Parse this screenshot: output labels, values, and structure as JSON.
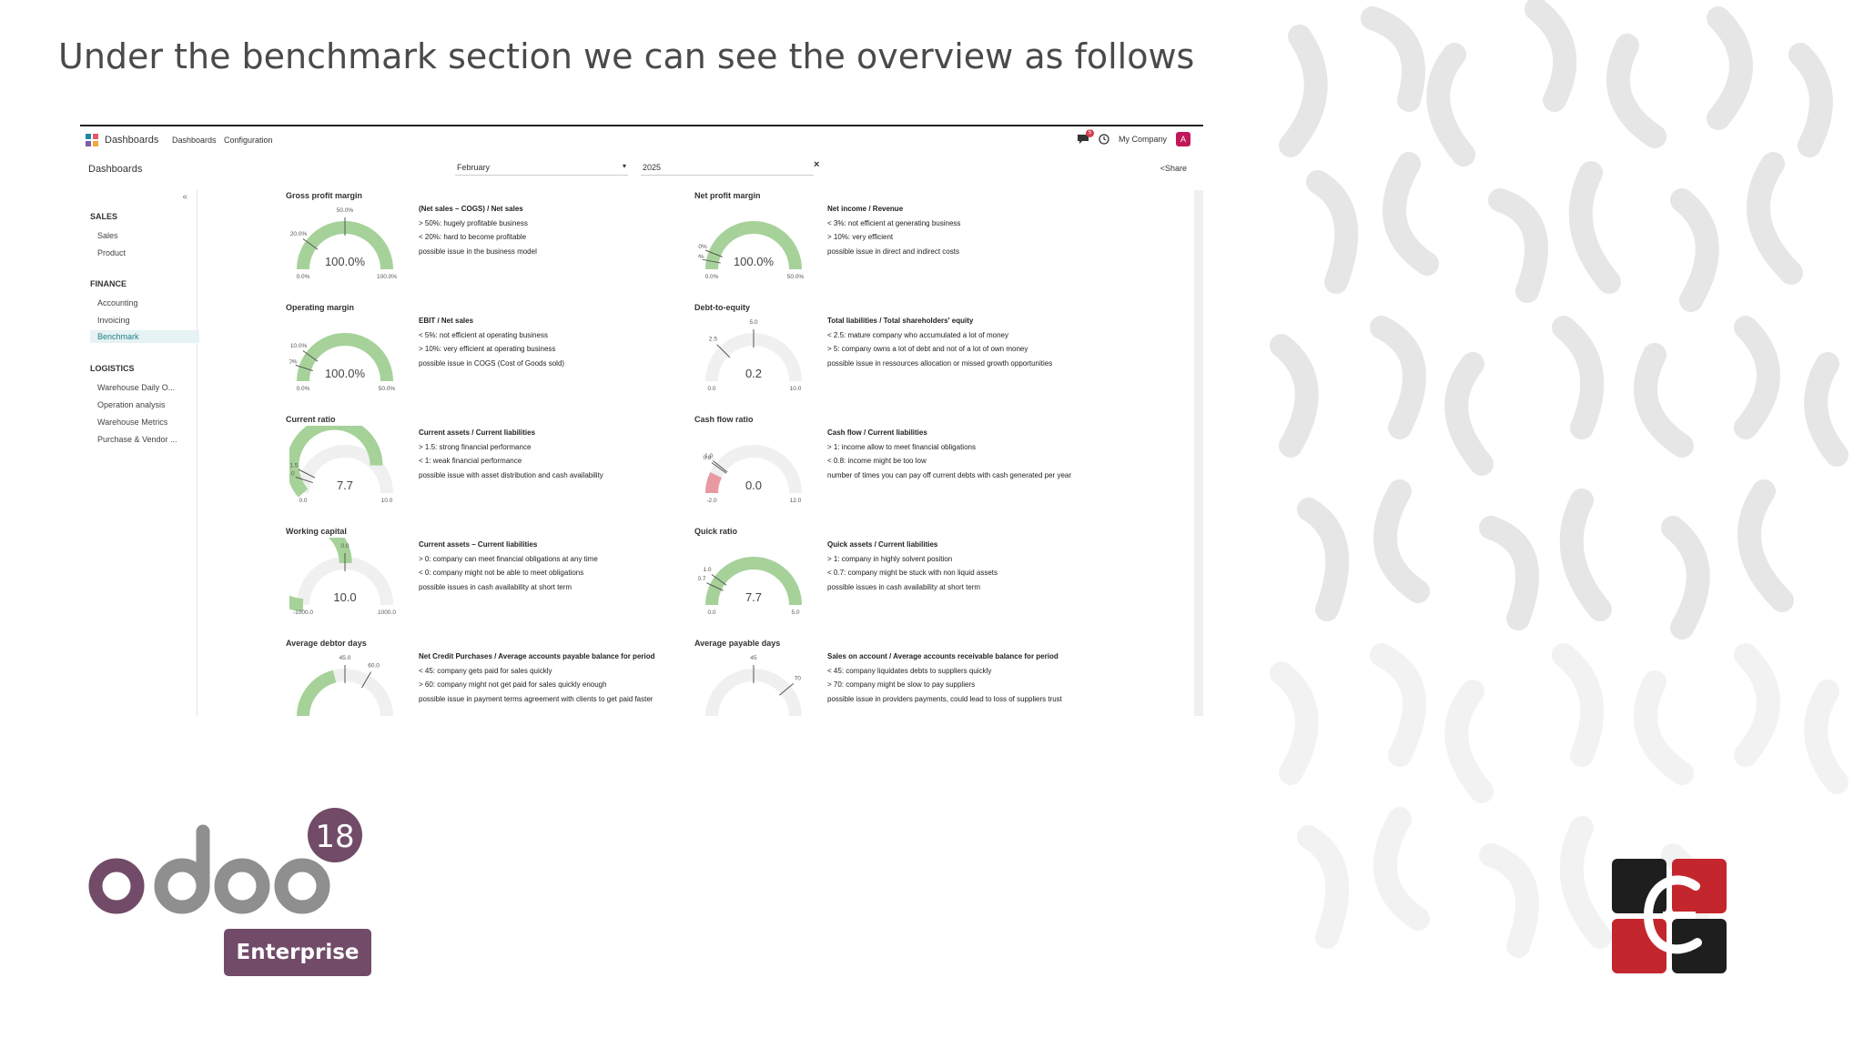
{
  "slide": {
    "title": "Under the benchmark section we can see the overview as follows"
  },
  "navbar": {
    "app_name": "Dashboards",
    "menu": [
      "Dashboards",
      "Configuration"
    ],
    "chat_badge": "5",
    "company": "My Company",
    "avatar_letter": "A"
  },
  "control": {
    "breadcrumb": "Dashboards",
    "month": "February",
    "year": "2025",
    "clear": "×",
    "share": "Share"
  },
  "sidebar": {
    "collapse": "«",
    "sections": [
      {
        "title": "SALES",
        "items": [
          "Sales",
          "Product"
        ]
      },
      {
        "title": "FINANCE",
        "items": [
          "Accounting",
          "Invoicing",
          "Benchmark"
        ]
      },
      {
        "title": "LOGISTICS",
        "items": [
          "Warehouse Daily O...",
          "Operation analysis",
          "Warehouse Metrics",
          "Purchase & Vendor ..."
        ]
      }
    ],
    "active": "Benchmark"
  },
  "metrics": [
    {
      "title": "Gross profit margin",
      "value": "100.0%",
      "min": "0.0%",
      "max": "100.0%",
      "fraction": 1.0,
      "color": "#a6d29a",
      "marks": [
        {
          "label": "20.0%",
          "f": 0.2
        },
        {
          "label": "50.0%",
          "f": 0.5
        }
      ],
      "formula": "(Net sales – COGS) / Net sales",
      "lines": [
        "> 50%: hugely profitable business",
        "< 20%: hard to become profitable",
        "possible issue in the business model"
      ]
    },
    {
      "title": "Net profit margin",
      "value": "100.0%",
      "min": "0.0%",
      "max": "50.0%",
      "fraction": 1.0,
      "color": "#a6d29a",
      "marks": [
        {
          "label": "3.0%",
          "f": 0.06
        },
        {
          "label": "6.0%",
          "f": 0.12
        }
      ],
      "formula": "Net income / Revenue",
      "lines": [
        "< 3%: not efficient at generating business",
        "> 10%: very efficient",
        "possible issue in direct and indirect costs"
      ]
    },
    {
      "title": "Operating margin",
      "value": "100.0%",
      "min": "0.0%",
      "max": "50.0%",
      "fraction": 1.0,
      "color": "#a6d29a",
      "marks": [
        {
          "label": "5.0%",
          "f": 0.1
        },
        {
          "label": "10.0%",
          "f": 0.2
        }
      ],
      "formula": "EBIT / Net sales",
      "lines": [
        "< 5%: not efficient at operating business",
        "> 10%: very efficient at operating business",
        "possible issue in COGS (Cost of Goods sold)"
      ]
    },
    {
      "title": "Debt-to-equity",
      "value": "0.2",
      "min": "0.0",
      "max": "10.0",
      "fraction": 0.0,
      "color": "#a6d29a",
      "marks": [
        {
          "label": "2.5",
          "f": 0.25
        },
        {
          "label": "5.0",
          "f": 0.5
        }
      ],
      "formula": "Total liabilities / Total shareholders' equity",
      "lines": [
        "< 2.5: mature company who accumulated a lot of money",
        "> 5: company owns a lot of debt and not of a lot of own money",
        "possible issue in ressources allocation or missed growth opportunities"
      ]
    },
    {
      "title": "Current ratio",
      "value": "7.7",
      "min": "0.0",
      "max": "10.0",
      "fraction": 0.77,
      "color": "#a6d29a",
      "marks": [
        {
          "label": "1.0",
          "f": 0.1
        },
        {
          "label": "1.5",
          "f": 0.15
        }
      ],
      "formula": "Current assets / Current liabilities",
      "lines": [
        "> 1.5: strong financial performance",
        "< 1: weak financial performance",
        "possible issue with asset distribution and cash availability"
      ]
    },
    {
      "title": "Cash flow ratio",
      "value": "0.0",
      "min": "-2.0",
      "max": "12.0",
      "fraction": 0.143,
      "color": "#e89aa0",
      "marks": [
        {
          "label": "0.8",
          "f": 0.2
        },
        {
          "label": "1.0",
          "f": 0.214
        }
      ],
      "formula": "Cash flow / Current liabilities",
      "lines": [
        "> 1: income allow to meet financial obligations",
        "< 0.8: income might be too low",
        "number of times you can pay off current debts with cash generated per year"
      ]
    },
    {
      "title": "Working capital",
      "value": "10.0",
      "min": "-1000.0",
      "max": "1000.0",
      "fraction": 0.505,
      "color": "#a6d29a",
      "marks": [
        {
          "label": "0.0",
          "f": 0.5
        }
      ],
      "formula": "Current assets – Current liabilities",
      "lines": [
        "> 0: company can meet financial obligations at any time",
        "< 0: company might not be able to meet obligations",
        "possible issues in cash availability at short term"
      ]
    },
    {
      "title": "Quick ratio",
      "value": "7.7",
      "min": "0.0",
      "max": "5.0",
      "fraction": 1.0,
      "color": "#a6d29a",
      "marks": [
        {
          "label": "0.7",
          "f": 0.14
        },
        {
          "label": "1.0",
          "f": 0.2
        }
      ],
      "formula": "Quick assets / Current liabilities",
      "lines": [
        "> 1: company in highly solvent position",
        "< 0.7: company might be stuck with non liquid assets",
        "possible issues in cash availability at short term"
      ]
    },
    {
      "title": "Average debtor days",
      "value": "",
      "min": "",
      "max": "",
      "fraction": 0.42,
      "color": "#a6d29a",
      "marks": [
        {
          "label": "45.0",
          "f": 0.5
        },
        {
          "label": "60.0",
          "f": 0.667
        }
      ],
      "formula": "Net Credit Purchases / Average accounts payable balance for period",
      "lines": [
        "< 45: company gets paid for sales quickly",
        "> 60: company might not get paid for sales quickly enough",
        "possible issue in payment terms agreement with clients to get paid faster"
      ]
    },
    {
      "title": "Average payable days",
      "value": "",
      "min": "",
      "max": "",
      "fraction": 0.0,
      "color": "#a6d29a",
      "marks": [
        {
          "label": "45",
          "f": 0.5
        },
        {
          "label": "70",
          "f": 0.778
        }
      ],
      "formula": "Sales on account / Average accounts receivable balance for period",
      "lines": [
        "< 45: company liquidates debts to suppliers quickly",
        "> 70: company might be slow to pay suppliers",
        "possible issue in providers payments, could lead to loss of suppliers trust"
      ]
    }
  ],
  "branding": {
    "odoo_wordmark": "odoo",
    "version": "18",
    "edition": "Enterprise",
    "colors": {
      "odoo_purple": "#714b67",
      "odoo_grey": "#8f8f8f",
      "ce_red": "#c4262e",
      "ce_black": "#1e1e1e"
    }
  }
}
